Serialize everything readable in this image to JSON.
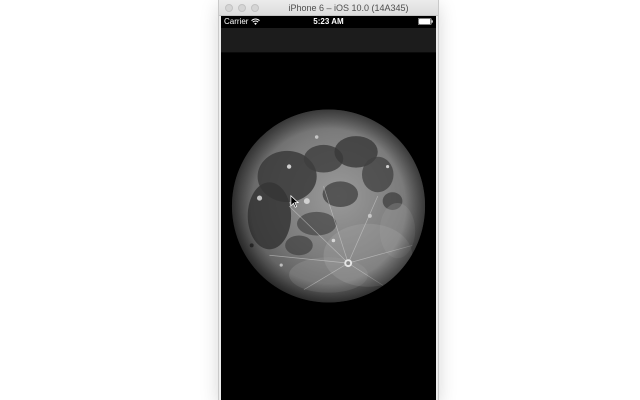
{
  "window": {
    "title": "iPhone 6 – iOS 10.0 (14A345)"
  },
  "status_bar": {
    "carrier": "Carrier",
    "time": "5:23 AM",
    "icons": [
      "wifi-icon",
      "battery-icon"
    ]
  },
  "content": {
    "image": "moon-image"
  },
  "colors": {
    "screen_background": "#000000",
    "navbar": "#1c1c1c",
    "status_text": "#ffffff"
  }
}
